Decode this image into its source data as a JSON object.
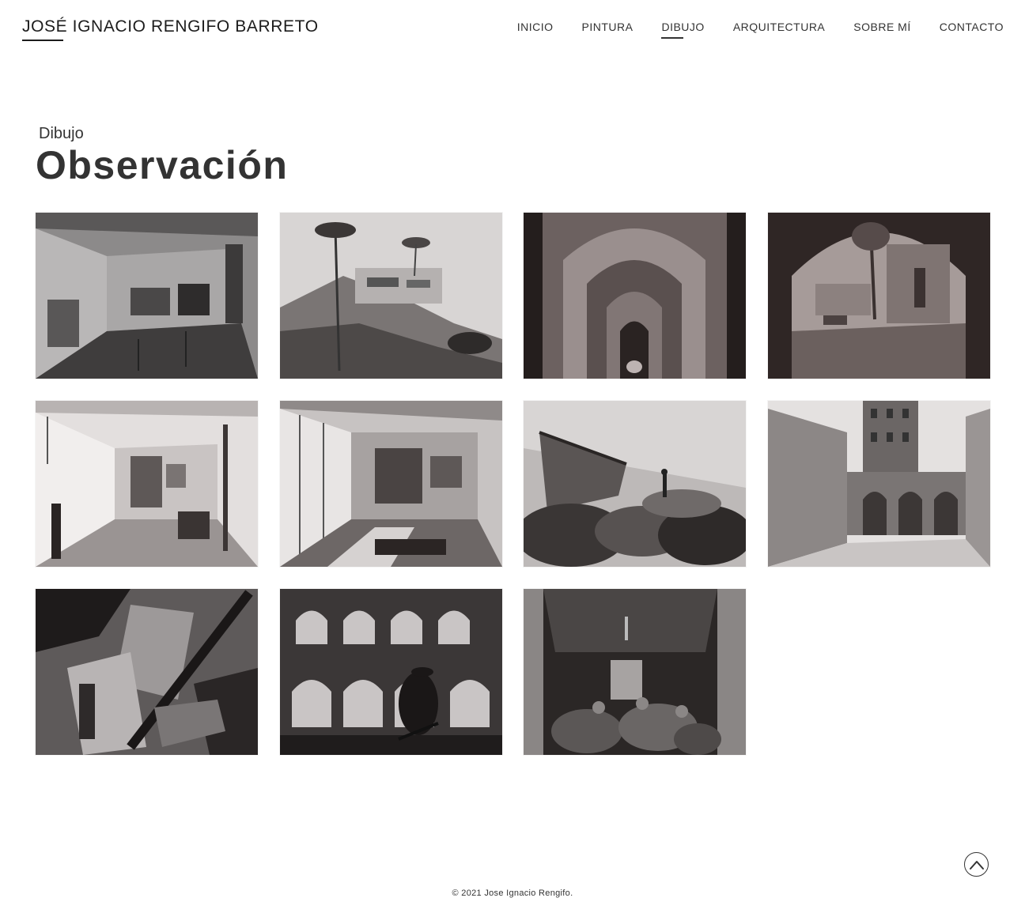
{
  "header": {
    "site_title": "JOSÉ IGNACIO RENGIFO BARRETO",
    "nav": [
      {
        "label": "INICIO",
        "active": false
      },
      {
        "label": "PINTURA",
        "active": false
      },
      {
        "label": "DIBUJO",
        "active": true
      },
      {
        "label": "ARQUITECTURA",
        "active": false
      },
      {
        "label": "SOBRE MÍ",
        "active": false
      },
      {
        "label": "CONTACTO",
        "active": false
      }
    ]
  },
  "page": {
    "breadcrumb": "Dibujo",
    "title": "Observación"
  },
  "gallery": {
    "items": [
      {
        "subject": "interior-room",
        "tone": "mid"
      },
      {
        "subject": "hillside-house",
        "tone": "light"
      },
      {
        "subject": "arched-corridor",
        "tone": "dark"
      },
      {
        "subject": "archway-plaza",
        "tone": "mid"
      },
      {
        "subject": "bright-interior",
        "tone": "light"
      },
      {
        "subject": "glass-interior",
        "tone": "light"
      },
      {
        "subject": "rocky-coast",
        "tone": "mid"
      },
      {
        "subject": "tower-courtyard",
        "tone": "light"
      },
      {
        "subject": "staircase-abstract",
        "tone": "dark"
      },
      {
        "subject": "arcade-figure",
        "tone": "dark"
      },
      {
        "subject": "dark-crowd-interior",
        "tone": "dark"
      }
    ]
  },
  "footer": {
    "copyright": "© 2021 Jose Ignacio Rengifo."
  },
  "colors": {
    "text": "#333333",
    "background": "#ffffff"
  },
  "icons": {
    "scroll_top": "chevron-up-circle-icon"
  }
}
